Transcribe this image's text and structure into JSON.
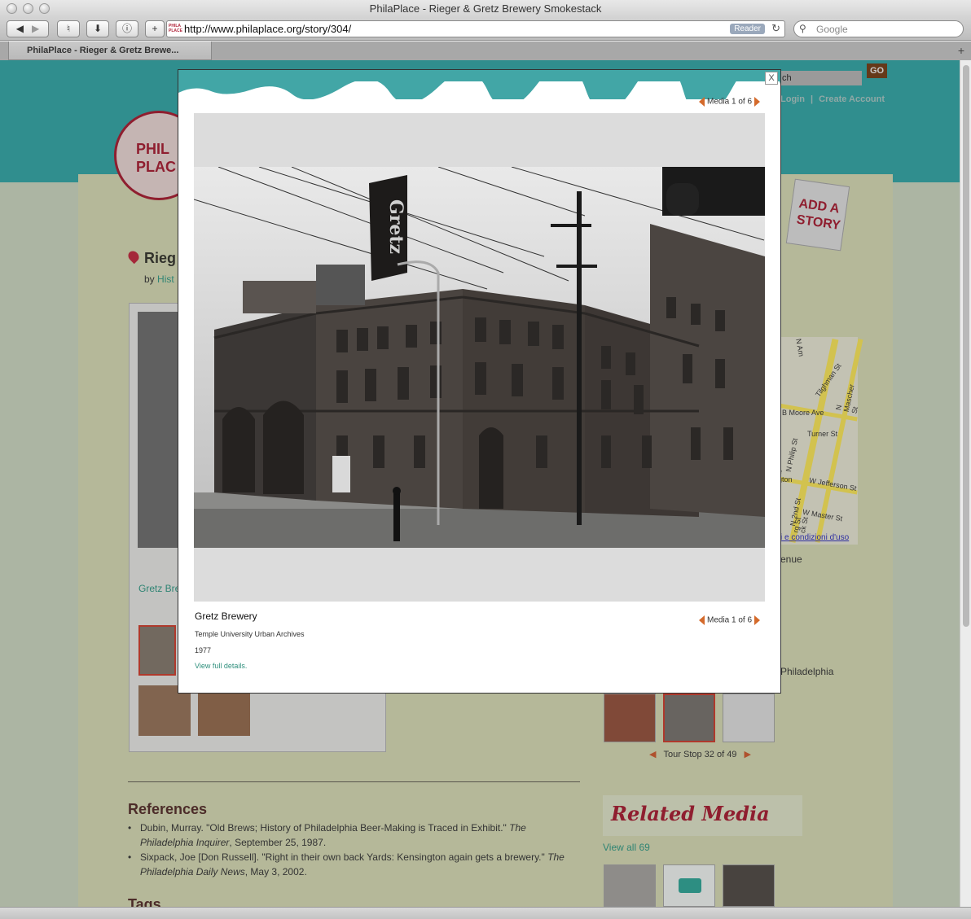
{
  "window": {
    "title": "PhilaPlace - Rieger & Gretz Brewery Smokestack"
  },
  "toolbar": {
    "url": "http://www.philaplace.org/story/304/",
    "favicon_text": "PHILA PLACE",
    "reader_label": "Reader",
    "search_placeholder": "Google"
  },
  "tabs": [
    {
      "label": "PhilaPlace - Rieger & Gretz Brewe..."
    }
  ],
  "header": {
    "search_value": "ch",
    "go_label": "GO",
    "login_label": "Login",
    "separator": "|",
    "create_account_label": "Create Account",
    "logo_line1": "PHIL",
    "logo_line2": "PLAC",
    "add_story_line1": "ADD A",
    "add_story_line2": "STORY"
  },
  "story": {
    "title_fragment": "Rieg",
    "by_label": "by",
    "author_fragment": "Hist",
    "caption_fragment": "Gretz Bre"
  },
  "sidebar": {
    "map_labels": [
      "N Am",
      "B Moore Ave",
      "Tilghman St",
      "N Mascher St",
      "Turner St",
      "N Philip St",
      "W Jefferson St",
      "gton",
      "W Master St",
      "N 2nd St",
      "ck St",
      "rg St",
      "e",
      "i e condizioni d'uso"
    ],
    "address_fragment": "enue",
    "city_fragment": "Philadelphia",
    "tour_stop": "Tour Stop 32 of 49",
    "related_media_title": "Related Media",
    "view_all": "View all 69"
  },
  "references": {
    "heading": "References",
    "items": [
      {
        "before": "Dubin, Murray. \"Old Brews; History of Philadelphia Beer-Making is Traced in Exhibit.\" ",
        "italic": "The Philadelphia Inquirer",
        "after": ", September 25, 1987."
      },
      {
        "before": "Sixpack, Joe [Don Russell]. \"Right in their own back Yards: Kensington again gets a brewery.\" ",
        "italic": "The Philadelphia Daily News",
        "after": ", May 3, 2002."
      }
    ],
    "tags_heading": "Tags"
  },
  "modal": {
    "close_label": "X",
    "media_counter": "Media 1 of 6",
    "caption_title": "Gretz Brewery",
    "caption_source": "Temple University Urban Archives",
    "caption_year": "1977",
    "view_details": "View full details.",
    "photo_signage": "Gretz"
  }
}
